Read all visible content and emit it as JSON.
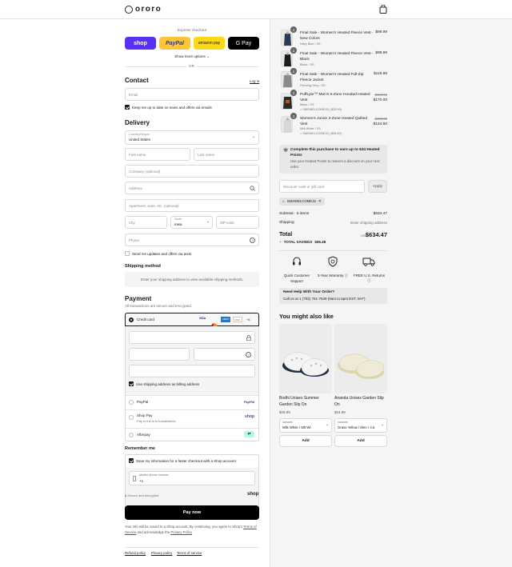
{
  "header": {
    "logo": "ororo"
  },
  "express": {
    "title": "Express checkout",
    "shop_pay": "shop",
    "paypal": "PayPal",
    "amazon_pay": "amazon pay",
    "gpay": "G Pay",
    "show_more": "Show more options",
    "or": "OR"
  },
  "contact": {
    "title": "Contact",
    "login": "Log in",
    "email_placeholder": "Email",
    "news_label": "Keep me up to date on news and offers via emails"
  },
  "delivery": {
    "title": "Delivery",
    "country_label": "Country/Region",
    "country_value": "United States",
    "first_name": "First name",
    "last_name": "Last name",
    "company": "Company (optional)",
    "address": "Address",
    "apartment": "Apartment, suite, etc. (optional)",
    "city": "City",
    "state_label": "State",
    "state_value": "Iowa",
    "zip": "ZIP code",
    "phone": "Phone",
    "text_label": "Send me updates and offers via texts"
  },
  "shipping": {
    "title": "Shipping method",
    "message": "Enter your shipping address to view available shipping methods."
  },
  "payment": {
    "title": "Payment",
    "subtitle": "All transactions are secure and encrypted.",
    "credit_card": "Credit card",
    "card_brands": [
      "VISA",
      "MC",
      "AMEX",
      "DISC",
      "+4"
    ],
    "billing_label": "Use shipping address as billing address",
    "paypal": "PayPal",
    "shop_pay": "Shop Pay",
    "shop_pay_sub": "Pay in full or in installments",
    "afterpay": "Afterpay"
  },
  "remember": {
    "title": "Remember me",
    "save_label": "Save my information for a faster checkout with a Shop account",
    "mobile_label": "Mobile phone number",
    "mobile_value": "+1",
    "secure": "Secure and encrypted",
    "shop": "shop"
  },
  "pay_now": "Pay now",
  "legal": {
    "prefix": "Your info will be saved to a Shop account. By continuing, you agree to Shop's",
    "tos": "Terms of Service",
    "mid": "and acknowledge the",
    "privacy": "Privacy Policy"
  },
  "footer": {
    "refund": "Refund policy",
    "privacy": "Privacy policy",
    "terms": "Terms of service"
  },
  "items": [
    {
      "qty": "1",
      "name": "Final Sale - Women's Heated Fleece Vest - New Colors",
      "variant": "Navy Blue / XS",
      "price": "$99.99",
      "color": "#2b3a55"
    },
    {
      "qty": "1",
      "name": "Final Sale - Women's Heated Fleece Vest - Black",
      "variant": "Black / XS",
      "price": "$99.99",
      "color": "#1c1c1c"
    },
    {
      "qty": "1",
      "name": "Final Sale - Women's Heated Full-Zip Fleece Jacket",
      "variant": "Flecking Grey / XS",
      "price": "$119.99",
      "color": "#8a8a8a"
    },
    {
      "qty": "1",
      "name": "PuffLyte™ Men's 5-Zone Hooded Heated Vest",
      "variant": "Black / XS",
      "discount": "SMSWELCOME15 (-$25.99)",
      "old_price": "$199.99",
      "price": "$170.00",
      "color": "#2a2a2a"
    },
    {
      "qty": "1",
      "name": "Women's Junior 4-Zone Heated Quilted Vest",
      "variant": "Milk White / XS",
      "discount": "SMSWELCOME15 (-$25.49)",
      "old_price": "$169.99",
      "price": "$144.50",
      "color": "#d8d8d8"
    }
  ],
  "heated_points": {
    "title": "Complete this purchase to earn up to 634 Heated Points",
    "desc": "Use your Heated Points to redeem a discount on your next order."
  },
  "discount": {
    "placeholder": "Discount code or gift card",
    "apply": "Apply",
    "tag": "SMSWELCOME15"
  },
  "totals": {
    "subtotal_label": "Subtotal · 5 items",
    "subtotal": "$634.47",
    "shipping_label": "Shipping",
    "shipping": "Enter shipping address",
    "total_label": "Total",
    "currency": "USD",
    "total": "$634.47",
    "savings_label": "TOTAL SAVINGS",
    "savings": "$55.48"
  },
  "features": [
    {
      "icon": "headset-icon",
      "label": "Quick Customer Support"
    },
    {
      "icon": "shield-icon",
      "label": "3-Year Warranty"
    },
    {
      "icon": "truck-icon",
      "label": "FREE U.S. Returns"
    }
  ],
  "help": {
    "title": "Need Help With Your Order?",
    "text": "Call us at 1 (702) 751-7639 (9am to 6pm EST, M-F)"
  },
  "upsell": {
    "title": "You might also like",
    "products": [
      {
        "name": "Bodhi Unisex Summer Garden Slip On",
        "price": "$29.99",
        "variant_label": "Variants",
        "variant": "Milk White / Mk:Wt",
        "add": "Add"
      },
      {
        "name": "Ananda Unisex Garden Slip On",
        "price": "$24.99",
        "variant_label": "Variants",
        "variant": "Grass Yellow / Men / 4.5",
        "add": "Add"
      }
    ]
  }
}
